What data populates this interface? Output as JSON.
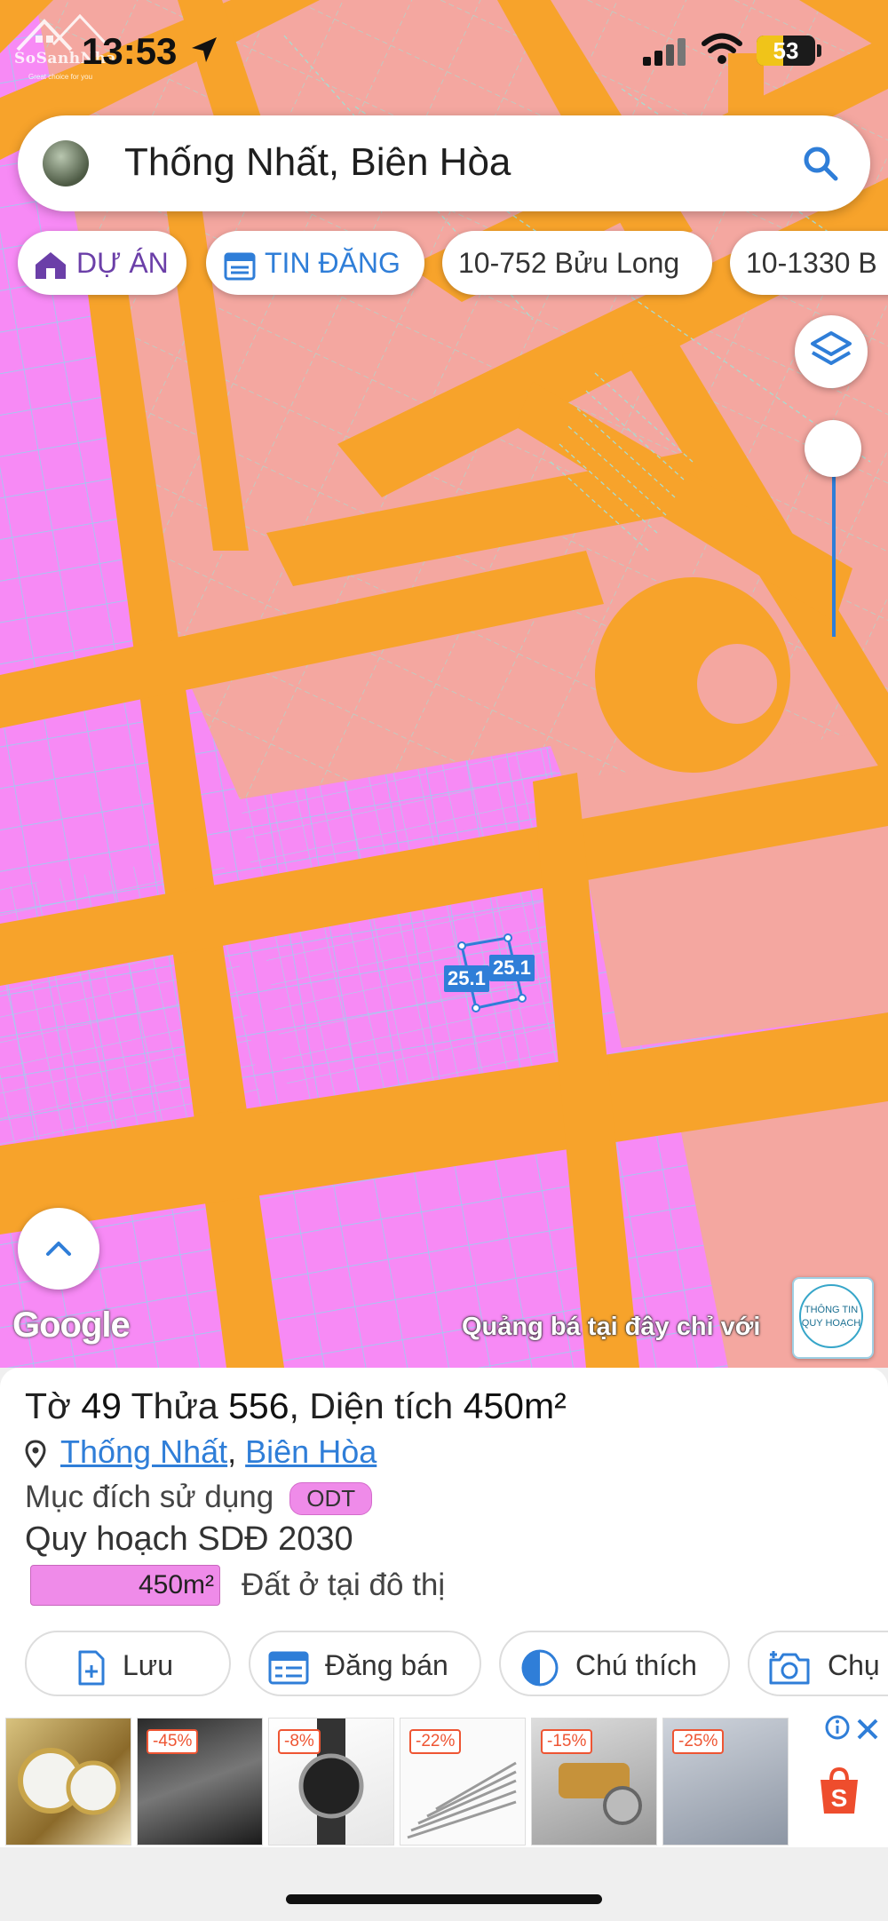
{
  "status": {
    "time": "13:53",
    "battery": "53"
  },
  "watermark": {
    "text": "SoSanhNha",
    "sub": "Great choice for you"
  },
  "search": {
    "text": "Thống Nhất, Biên Hòa"
  },
  "chips": [
    {
      "label": "DỰ ÁN",
      "icon": "house-icon"
    },
    {
      "label": "TIN ĐĂNG",
      "icon": "calendar-icon"
    },
    {
      "label": "10-752 Bửu Long"
    },
    {
      "label": "10-1330 B"
    }
  ],
  "map": {
    "plot_label_a": "25.1",
    "plot_label_b": "25.1",
    "google": "Google",
    "promo": "Quảng bá tại đây chỉ với",
    "qh_badge": "THÔNG TIN QUY HOẠCH",
    "colors": {
      "residential": "#f78af5",
      "planned": "#f4a7a0",
      "road": "#f7a32b",
      "selection": "#2f7ed8"
    }
  },
  "panel": {
    "to_label": "Tờ",
    "to_value": "49",
    "thua_label": "Thửa",
    "thua_value": "556",
    "area_label": "Diện tích",
    "area_value": "450m²",
    "ward": "Thống Nhất",
    "city": "Biên Hòa",
    "use_label": "Mục đích sử dụng",
    "use_code": "ODT",
    "plan_label": "Quy hoạch SDĐ 2030",
    "plan_area": "450m²",
    "plan_desc": "Đất ở tại đô thị"
  },
  "actions": [
    {
      "label": "Lưu",
      "icon": "add-file-icon"
    },
    {
      "label": "Đăng bán",
      "icon": "listing-icon"
    },
    {
      "label": "Chú thích",
      "icon": "half-circle-icon"
    },
    {
      "label": "Chụ",
      "icon": "camera-icon"
    }
  ],
  "ads": [
    {
      "discount": ""
    },
    {
      "discount": "-45%"
    },
    {
      "discount": "-8%"
    },
    {
      "discount": "-22%"
    },
    {
      "discount": "-15%"
    },
    {
      "discount": "-25%"
    }
  ]
}
